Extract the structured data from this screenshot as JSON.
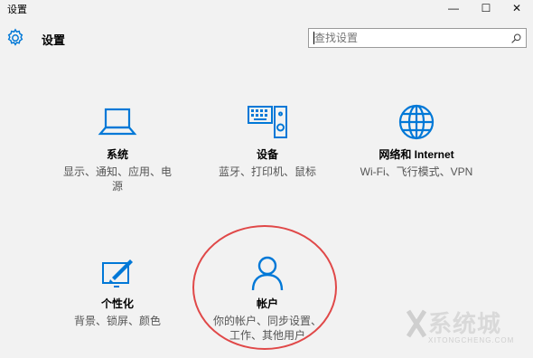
{
  "window": {
    "title": "设置",
    "minimize": "—",
    "maximize": "☐",
    "close": "✕"
  },
  "header": {
    "title": "设置",
    "gear_icon": "gear-icon"
  },
  "search": {
    "placeholder": "查找设置",
    "icon": "search-icon"
  },
  "tiles": [
    {
      "icon": "laptop-icon",
      "title": "系统",
      "desc": "显示、通知、应用、电源"
    },
    {
      "icon": "devices-icon",
      "title": "设备",
      "desc": "蓝牙、打印机、鼠标"
    },
    {
      "icon": "globe-icon",
      "title": "网络和 Internet",
      "desc": "Wi-Fi、飞行模式、VPN"
    },
    {
      "icon": "personalize-icon",
      "title": "个性化",
      "desc": "背景、锁屏、颜色"
    },
    {
      "icon": "account-icon",
      "title": "帐户",
      "desc": "你的帐户、同步设置、工作、其他用户"
    }
  ],
  "watermark": {
    "text": "系统城",
    "sub": "XITONGCHENG.COM"
  },
  "colors": {
    "accent": "#0078d7",
    "annotation": "#e04848",
    "background": "#f2f2f2"
  }
}
